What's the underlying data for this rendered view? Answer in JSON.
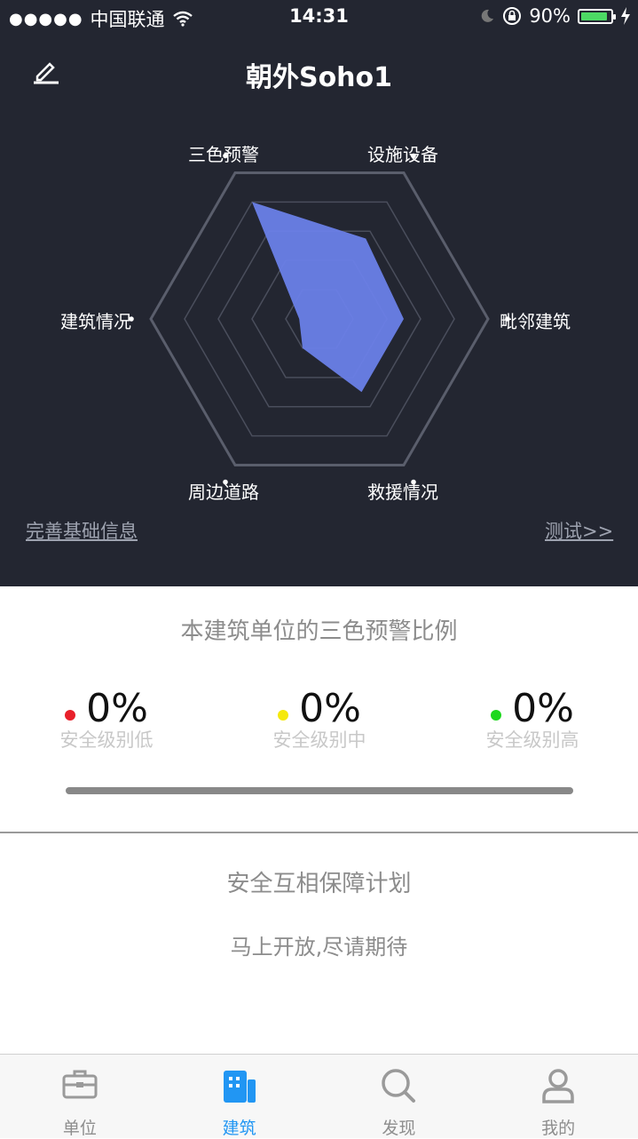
{
  "status_bar": {
    "signal": "●●●●●",
    "carrier": "中国联通",
    "time": "14:31",
    "battery": "90%",
    "battery_level": 0.9
  },
  "header": {
    "title": "朝外Soho1",
    "edit_icon": "pencil-icon"
  },
  "radar": {
    "axes": [
      "三色预警",
      "设施设备",
      "毗邻建筑",
      "救援情况",
      "周边道路",
      "建筑情况"
    ],
    "values": [
      0.8,
      0.55,
      0.5,
      0.5,
      0.2,
      0.12
    ],
    "max": 1,
    "levels": 5,
    "fill_color": "#6a80e8",
    "grid_color": "#4a4e5c"
  },
  "links": {
    "complete_info": "完善基础信息",
    "test": "测试>>"
  },
  "warning_section": {
    "title": "本建筑单位的三色预警比例",
    "stats": [
      {
        "value": "0%",
        "label": "安全级别低",
        "color": "#e8202a"
      },
      {
        "value": "0%",
        "label": "安全级别中",
        "color": "#f5e90c"
      },
      {
        "value": "0%",
        "label": "安全级别高",
        "color": "#1ed81e"
      }
    ]
  },
  "plan_section": {
    "title": "安全互相保障计划",
    "subtitle": "马上开放,尽请期待"
  },
  "tabs": [
    {
      "label": "单位",
      "icon": "briefcase-icon",
      "active": false
    },
    {
      "label": "建筑",
      "icon": "building-icon",
      "active": true
    },
    {
      "label": "发现",
      "icon": "search-icon",
      "active": false
    },
    {
      "label": "我的",
      "icon": "user-icon",
      "active": false
    }
  ]
}
